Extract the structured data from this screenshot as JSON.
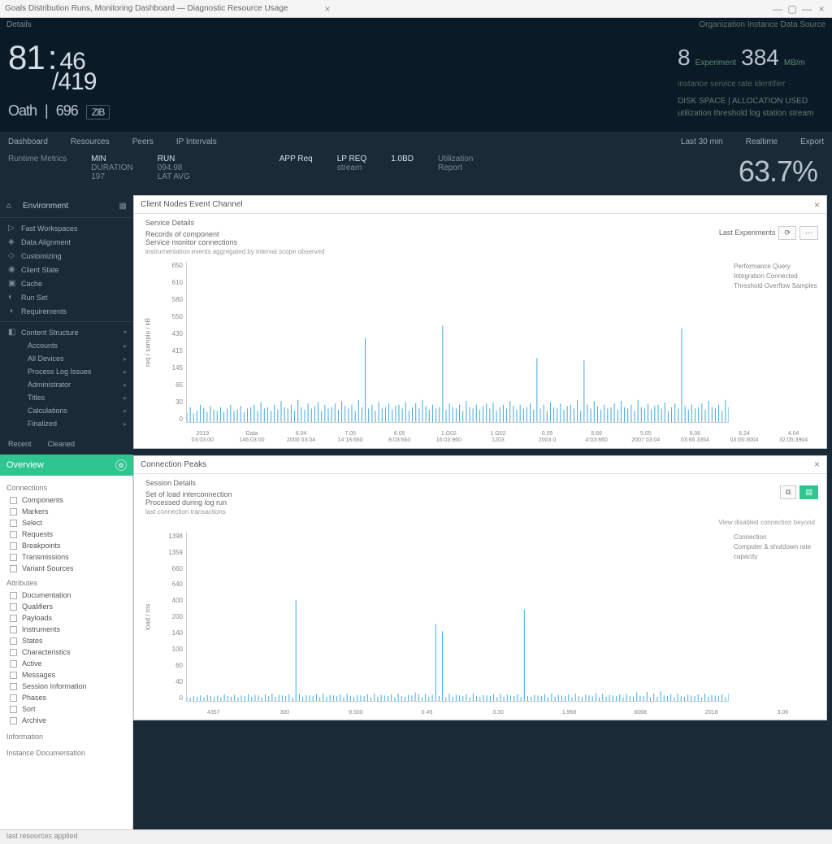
{
  "titlebar": {
    "text": "Goals Distribution Runs, Monitoring Dashboard — Diagnostic Resource Usage"
  },
  "header": {
    "menu_left": "Details",
    "menu_right": "Organization Instance Data Source",
    "big": {
      "a": "81",
      "b": "46",
      "c": "419"
    },
    "sub": {
      "a": "Oath",
      "b": "696",
      "c": "ZIB"
    },
    "right": {
      "mini_a": "8",
      "mini_b": "384",
      "mini_unit": "MB/m",
      "label1": "Experiment",
      "line1": "instance service rate identifier",
      "block_a": "DISK SPACE | ALLOCATION USED",
      "block_b": "utilization threshold log station stream"
    }
  },
  "nav": {
    "tabs": [
      "Dashboard",
      "Resources",
      "Peers",
      "IP Intervals"
    ],
    "right": [
      "Last 30 min",
      "Realtime",
      "Export"
    ]
  },
  "stats": {
    "heading": "Runtime Metrics",
    "blocks": [
      {
        "l1": "MIN",
        "l2": "DURATION",
        "l3": "197"
      },
      {
        "l1": "RUN",
        "l2": "094.98",
        "l3": "LAT AVG"
      },
      {
        "l1": "APP Req",
        "l2": "—",
        "l3": "—"
      },
      {
        "l1": "LP REQ",
        "l2": "stream",
        "l3": "—"
      },
      {
        "l1": "1.0BD",
        "l2": "—",
        "l3": "—"
      },
      {
        "l1": "Utilization",
        "l2": "Report",
        "l3": "—"
      }
    ],
    "bignum": "63.7%"
  },
  "sidebar": {
    "header": "Environment",
    "items": [
      "Fast Workspaces",
      "Data Alignment",
      "Customizing",
      "Client State",
      "Cache",
      "Run Set",
      "Requirements"
    ],
    "section2": "Content Structure",
    "sub_items": [
      "Accounts",
      "All Devices",
      "Process Log Issues",
      "Administrator",
      "Titles",
      "Calculations",
      "Finalized"
    ],
    "light_header": "Overview",
    "section_a": "Connections",
    "checks_a": [
      "Components",
      "Markers",
      "Select",
      "Requests",
      "Breakpoints",
      "Transmissions",
      "Variant Sources"
    ],
    "section_b": "Attributes",
    "checks_b": [
      "Documentation",
      "Qualifiers",
      "Payloads",
      "Instruments",
      "States",
      "Characteristics",
      "Active",
      "Messages",
      "Session Information",
      "Phases",
      "Sort",
      "Archive"
    ],
    "section_c": "Information",
    "section_d": "Instance Documentation"
  },
  "panels": {
    "a": {
      "title": "Client Nodes Event Channel",
      "subtitle": "Service Details",
      "line1": "Records of component",
      "line2": "Service monitor connections",
      "note": "instrumentation events aggregated by interval scope observed",
      "legend_hdr": "Last Experiments",
      "legend": [
        "Performance Query",
        "Integration Connected",
        "Threshold Overflow Samples"
      ],
      "right_ctl": "⟳"
    },
    "b": {
      "title": "Connection Peaks",
      "subtitle": "Session Details",
      "line1": "Set of load interconnection",
      "line2": "Processed during log run",
      "note": "last connection transactions",
      "legend_hdr": "View disabled connection beyond",
      "legend": [
        "Connection",
        "Computer & shutdown rate capacity"
      ]
    }
  },
  "chart_data": [
    {
      "type": "bar",
      "title": "Client Nodes Event Channel",
      "ylabel": "req / sample / kB",
      "ylim": [
        0,
        650
      ],
      "y_ticks": [
        0,
        30,
        65,
        145,
        415,
        430,
        550,
        580,
        610,
        650
      ],
      "x_ticks": [
        {
          "t": "2019",
          "s": "03:03:00"
        },
        {
          "t": "Data",
          "s": "146:03:00"
        },
        {
          "t": "6.04",
          "s": "2000 03:04"
        },
        {
          "t": "7.05",
          "s": "14:18:660"
        },
        {
          "t": "6.05",
          "s": "8:03:660"
        },
        {
          "t": "1.G02",
          "s": "16:03:960"
        },
        {
          "t": "1.G02",
          "s": "1203"
        },
        {
          "t": "0.05",
          "s": "2003 0"
        },
        {
          "t": "5.66",
          "s": "4:03:660"
        },
        {
          "t": "5.05",
          "s": "2007 03:04"
        },
        {
          "t": "6.06",
          "s": "03:66 3354"
        },
        {
          "t": "6.24",
          "s": "03:05:3004"
        },
        {
          "t": "4.04",
          "s": "32:05:3904"
        }
      ],
      "values": [
        40,
        60,
        35,
        45,
        70,
        55,
        40,
        65,
        50,
        45,
        60,
        40,
        55,
        70,
        45,
        50,
        65,
        40,
        55,
        60,
        70,
        45,
        80,
        55,
        60,
        45,
        70,
        50,
        85,
        60,
        55,
        70,
        45,
        90,
        60,
        50,
        75,
        55,
        65,
        80,
        45,
        70,
        55,
        60,
        75,
        50,
        85,
        65,
        55,
        70,
        45,
        90,
        60,
        340,
        55,
        70,
        45,
        80,
        55,
        60,
        75,
        50,
        65,
        70,
        55,
        80,
        45,
        60,
        75,
        55,
        90,
        65,
        50,
        70,
        55,
        60,
        390,
        50,
        75,
        60,
        55,
        70,
        45,
        85,
        60,
        55,
        70,
        50,
        65,
        75,
        55,
        80,
        45,
        60,
        70,
        55,
        85,
        65,
        50,
        70,
        55,
        60,
        75,
        50,
        260,
        55,
        70,
        45,
        80,
        60,
        55,
        75,
        50,
        65,
        70,
        55,
        90,
        45,
        250,
        70,
        55,
        85,
        65,
        50,
        70,
        55,
        60,
        75,
        50,
        85,
        60,
        55,
        70,
        45,
        90,
        60,
        55,
        75,
        50,
        65,
        70,
        55,
        80,
        45,
        60,
        75,
        55,
        380,
        65,
        50,
        70,
        55,
        60,
        75,
        50,
        85,
        60,
        55,
        70,
        45,
        90,
        60
      ]
    },
    {
      "type": "bar",
      "title": "Connection Peaks",
      "ylabel": "load / ms",
      "ylim": [
        0,
        1400
      ],
      "y_ticks": [
        0,
        40,
        60,
        100,
        140,
        200,
        400,
        640,
        660,
        1359,
        1398
      ],
      "x_ticks": [
        {
          "t": "4357",
          "s": ""
        },
        {
          "t": "300",
          "s": ""
        },
        {
          "t": "9.500",
          "s": ""
        },
        {
          "t": "0.45",
          "s": ""
        },
        {
          "t": "3.30",
          "s": ""
        },
        {
          "t": "1.968",
          "s": ""
        },
        {
          "t": "6068",
          "s": ""
        },
        {
          "t": "2018",
          "s": ""
        },
        {
          "t": "3.06",
          "s": ""
        }
      ],
      "values": [
        30,
        25,
        40,
        35,
        45,
        30,
        50,
        40,
        35,
        45,
        30,
        55,
        40,
        35,
        50,
        30,
        45,
        40,
        55,
        35,
        50,
        45,
        30,
        55,
        40,
        60,
        35,
        50,
        45,
        40,
        55,
        30,
        840,
        60,
        35,
        50,
        45,
        40,
        55,
        30,
        60,
        35,
        50,
        45,
        40,
        55,
        30,
        60,
        40,
        35,
        50,
        45,
        40,
        55,
        30,
        60,
        35,
        50,
        45,
        40,
        55,
        30,
        60,
        40,
        35,
        50,
        45,
        70,
        55,
        30,
        60,
        35,
        50,
        640,
        40,
        580,
        30,
        60,
        35,
        50,
        45,
        40,
        55,
        30,
        60,
        40,
        35,
        50,
        45,
        40,
        55,
        30,
        60,
        35,
        50,
        45,
        40,
        55,
        30,
        760,
        40,
        35,
        50,
        45,
        40,
        55,
        30,
        60,
        35,
        50,
        45,
        40,
        55,
        30,
        60,
        40,
        35,
        50,
        45,
        40,
        65,
        30,
        60,
        35,
        50,
        45,
        40,
        55,
        30,
        60,
        40,
        35,
        70,
        45,
        40,
        75,
        30,
        60,
        35,
        80,
        45,
        40,
        55,
        30,
        60,
        40,
        35,
        50,
        45,
        40,
        55,
        30,
        60,
        35,
        50,
        45,
        40,
        55,
        30,
        60
      ]
    }
  ],
  "footer": "last resources applied"
}
